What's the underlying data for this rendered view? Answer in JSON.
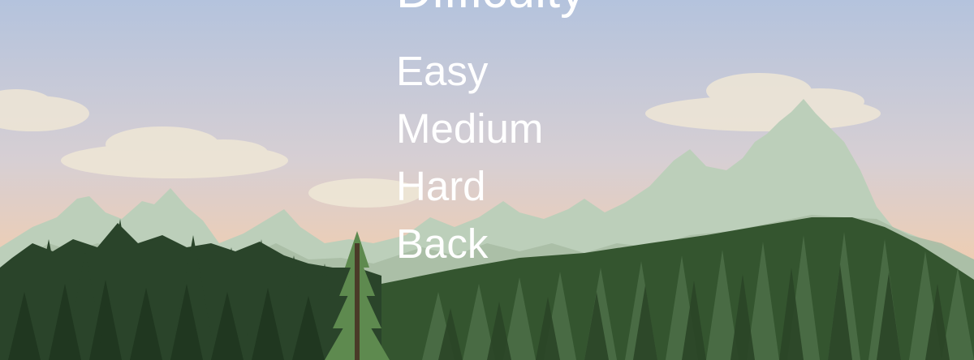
{
  "menu": {
    "title": "Difficulty",
    "items": [
      "Easy",
      "Medium",
      "Hard",
      "Back"
    ]
  },
  "colors": {
    "sky_top": "#b4c3dd",
    "sky_bottom": "#f6c9a2",
    "cloud": "#efe7d6",
    "mountains_far": "#b9ccb7",
    "mountains_near": "#a9bda6",
    "forest_dark": "#2c4a2c",
    "forest_mid": "#4a6a47",
    "menu_text": "#ffffff"
  }
}
